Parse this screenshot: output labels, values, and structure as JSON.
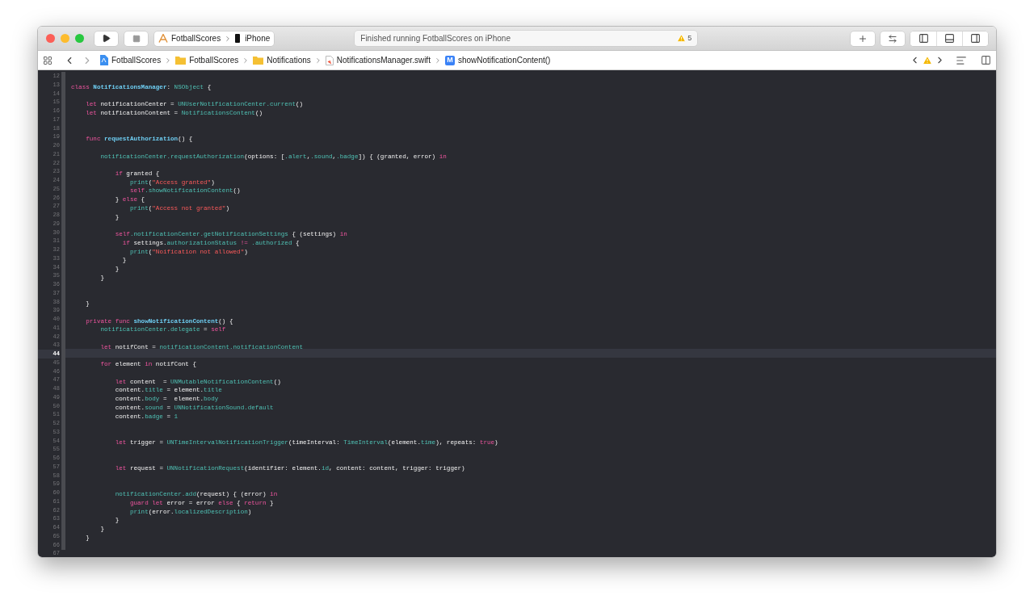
{
  "toolbar": {
    "scheme": {
      "project": "FotballScores",
      "device": "iPhone"
    },
    "activity": {
      "status": "Finished running FotballScores on iPhone",
      "warnings": "5"
    },
    "panels": [
      {
        "kind": "navigator",
        "selected": false
      },
      {
        "kind": "debug",
        "selected": false
      },
      {
        "kind": "inspector",
        "selected": false
      }
    ]
  },
  "jump_bar": {
    "crumbs": [
      {
        "kind": "project",
        "label": "FotballScores"
      },
      {
        "kind": "folder",
        "label": "FotballScores"
      },
      {
        "kind": "folder",
        "label": "Notifications"
      },
      {
        "kind": "file",
        "label": "NotificationsManager.swift"
      },
      {
        "kind": "method",
        "badge": "M",
        "label": "showNotificationContent()"
      }
    ]
  },
  "editor": {
    "lines": [
      {
        "number": "12",
        "current": false
      },
      {
        "number": "13",
        "current": false,
        "tokens": [
          {
            "kind": "keyword",
            "text": "class "
          },
          {
            "kind": "decl",
            "text": "NotificationsManager"
          },
          {
            "kind": "plain",
            "text": ": "
          },
          {
            "kind": "type",
            "text": "NSObject"
          },
          {
            "kind": "plain",
            "text": " {"
          }
        ]
      },
      {
        "number": "14",
        "current": false
      },
      {
        "number": "15",
        "current": false,
        "tokens": [
          {
            "kind": "keyword",
            "text": "    let "
          },
          {
            "kind": "plain",
            "text": "notificationCenter = "
          },
          {
            "kind": "type",
            "text": "UNUserNotificationCenter.current"
          },
          {
            "kind": "plain",
            "text": "()"
          }
        ]
      },
      {
        "number": "16",
        "current": false,
        "tokens": [
          {
            "kind": "keyword",
            "text": "    let "
          },
          {
            "kind": "plain",
            "text": "notificationContent = "
          },
          {
            "kind": "type",
            "text": "NotificationsContent"
          },
          {
            "kind": "plain",
            "text": "()"
          }
        ]
      },
      {
        "number": "17",
        "current": false
      },
      {
        "number": "18",
        "current": false
      },
      {
        "number": "19",
        "current": false,
        "tokens": [
          {
            "kind": "keyword",
            "text": "    func "
          },
          {
            "kind": "decl",
            "text": "requestAuthorization"
          },
          {
            "kind": "plain",
            "text": "() {"
          }
        ]
      },
      {
        "number": "20",
        "current": false
      },
      {
        "number": "21",
        "current": false,
        "tokens": [
          {
            "kind": "type",
            "text": "        notificationCenter.requestAuthorization"
          },
          {
            "kind": "plain",
            "text": "(options: ["
          },
          {
            "kind": "type",
            "text": ".alert"
          },
          {
            "kind": "plain",
            "text": ","
          },
          {
            "kind": "type",
            "text": ".sound"
          },
          {
            "kind": "plain",
            "text": ","
          },
          {
            "kind": "type",
            "text": ".badge"
          },
          {
            "kind": "plain",
            "text": "]) { (granted, error) "
          },
          {
            "kind": "keyword",
            "text": "in"
          }
        ]
      },
      {
        "number": "22",
        "current": false
      },
      {
        "number": "23",
        "current": false,
        "tokens": [
          {
            "kind": "keyword",
            "text": "            if "
          },
          {
            "kind": "plain",
            "text": "granted {"
          }
        ]
      },
      {
        "number": "24",
        "current": false,
        "tokens": [
          {
            "kind": "type",
            "text": "                print"
          },
          {
            "kind": "plain",
            "text": "("
          },
          {
            "kind": "string",
            "text": "\"Access granted\""
          },
          {
            "kind": "plain",
            "text": ")"
          }
        ]
      },
      {
        "number": "25",
        "current": false,
        "tokens": [
          {
            "kind": "keyword",
            "text": "                self"
          },
          {
            "kind": "type",
            "text": ".showNotificationContent"
          },
          {
            "kind": "plain",
            "text": "()"
          }
        ]
      },
      {
        "number": "26",
        "current": false,
        "tokens": [
          {
            "kind": "plain",
            "text": "            } "
          },
          {
            "kind": "keyword",
            "text": "else"
          },
          {
            "kind": "plain",
            "text": " {"
          }
        ]
      },
      {
        "number": "27",
        "current": false,
        "tokens": [
          {
            "kind": "type",
            "text": "                print"
          },
          {
            "kind": "plain",
            "text": "("
          },
          {
            "kind": "string",
            "text": "\"Access not granted\""
          },
          {
            "kind": "plain",
            "text": ")"
          }
        ]
      },
      {
        "number": "28",
        "current": false,
        "tokens": [
          {
            "kind": "plain",
            "text": "            }"
          }
        ]
      },
      {
        "number": "29",
        "current": false
      },
      {
        "number": "30",
        "current": false,
        "tokens": [
          {
            "kind": "keyword",
            "text": "            self"
          },
          {
            "kind": "type",
            "text": ".notificationCenter.getNotificationSettings"
          },
          {
            "kind": "plain",
            "text": " { (settings) "
          },
          {
            "kind": "keyword",
            "text": "in"
          }
        ]
      },
      {
        "number": "31",
        "current": false,
        "tokens": [
          {
            "kind": "keyword",
            "text": "              if "
          },
          {
            "kind": "plain",
            "text": "settings."
          },
          {
            "kind": "type",
            "text": "authorizationStatus"
          },
          {
            "kind": "keyword",
            "text": " != "
          },
          {
            "kind": "type",
            "text": ".authorized"
          },
          {
            "kind": "plain",
            "text": " {"
          }
        ]
      },
      {
        "number": "32",
        "current": false,
        "tokens": [
          {
            "kind": "type",
            "text": "                print"
          },
          {
            "kind": "plain",
            "text": "("
          },
          {
            "kind": "string",
            "text": "\"Noification not allowed\""
          },
          {
            "kind": "plain",
            "text": ")"
          }
        ]
      },
      {
        "number": "33",
        "current": false,
        "tokens": [
          {
            "kind": "plain",
            "text": "              }"
          }
        ]
      },
      {
        "number": "34",
        "current": false,
        "tokens": [
          {
            "kind": "plain",
            "text": "            }"
          }
        ]
      },
      {
        "number": "35",
        "current": false,
        "tokens": [
          {
            "kind": "plain",
            "text": "        }"
          }
        ]
      },
      {
        "number": "36",
        "current": false
      },
      {
        "number": "37",
        "current": false
      },
      {
        "number": "38",
        "current": false,
        "tokens": [
          {
            "kind": "plain",
            "text": "    }"
          }
        ]
      },
      {
        "number": "39",
        "current": false
      },
      {
        "number": "40",
        "current": false,
        "tokens": [
          {
            "kind": "keyword",
            "text": "    private func "
          },
          {
            "kind": "decl",
            "text": "showNotificationContent"
          },
          {
            "kind": "plain",
            "text": "() {"
          }
        ]
      },
      {
        "number": "41",
        "current": false,
        "tokens": [
          {
            "kind": "type",
            "text": "        notificationCenter.delegate"
          },
          {
            "kind": "plain",
            "text": " = "
          },
          {
            "kind": "keyword",
            "text": "self"
          }
        ]
      },
      {
        "number": "42",
        "current": false
      },
      {
        "number": "43",
        "current": false,
        "tokens": [
          {
            "kind": "keyword",
            "text": "        let "
          },
          {
            "kind": "plain",
            "text": "notifCont = "
          },
          {
            "kind": "type",
            "text": "notificationContent.notificationContent"
          }
        ]
      },
      {
        "number": "44",
        "current": true
      },
      {
        "number": "45",
        "current": false,
        "tokens": [
          {
            "kind": "keyword",
            "text": "        for "
          },
          {
            "kind": "plain",
            "text": "element "
          },
          {
            "kind": "keyword",
            "text": "in "
          },
          {
            "kind": "plain",
            "text": "notifCont {"
          }
        ]
      },
      {
        "number": "46",
        "current": false
      },
      {
        "number": "47",
        "current": false,
        "tokens": [
          {
            "kind": "keyword",
            "text": "            let "
          },
          {
            "kind": "plain",
            "text": "content  = "
          },
          {
            "kind": "type",
            "text": "UNMutableNotificationContent"
          },
          {
            "kind": "plain",
            "text": "()"
          }
        ]
      },
      {
        "number": "48",
        "current": false,
        "tokens": [
          {
            "kind": "plain",
            "text": "            content."
          },
          {
            "kind": "type",
            "text": "title"
          },
          {
            "kind": "plain",
            "text": " = element."
          },
          {
            "kind": "type",
            "text": "title"
          }
        ]
      },
      {
        "number": "49",
        "current": false,
        "tokens": [
          {
            "kind": "plain",
            "text": "            content."
          },
          {
            "kind": "type",
            "text": "body"
          },
          {
            "kind": "plain",
            "text": " =  element."
          },
          {
            "kind": "type",
            "text": "body"
          }
        ]
      },
      {
        "number": "50",
        "current": false,
        "tokens": [
          {
            "kind": "plain",
            "text": "            content."
          },
          {
            "kind": "type",
            "text": "sound"
          },
          {
            "kind": "plain",
            "text": " = "
          },
          {
            "kind": "type",
            "text": "UNNotificationSound.default"
          }
        ]
      },
      {
        "number": "51",
        "current": false,
        "tokens": [
          {
            "kind": "plain",
            "text": "            content."
          },
          {
            "kind": "type",
            "text": "badge"
          },
          {
            "kind": "plain",
            "text": " = "
          },
          {
            "kind": "type",
            "text": "1"
          }
        ]
      },
      {
        "number": "52",
        "current": false
      },
      {
        "number": "53",
        "current": false
      },
      {
        "number": "54",
        "current": false,
        "tokens": [
          {
            "kind": "keyword",
            "text": "            let "
          },
          {
            "kind": "plain",
            "text": "trigger = "
          },
          {
            "kind": "type",
            "text": "UNTimeIntervalNotificationTrigger"
          },
          {
            "kind": "plain",
            "text": "(timeInterval: "
          },
          {
            "kind": "type",
            "text": "TimeInterval"
          },
          {
            "kind": "plain",
            "text": "(element."
          },
          {
            "kind": "type",
            "text": "time"
          },
          {
            "kind": "plain",
            "text": "), repeats: "
          },
          {
            "kind": "keyword",
            "text": "true"
          },
          {
            "kind": "plain",
            "text": ")"
          }
        ]
      },
      {
        "number": "55",
        "current": false
      },
      {
        "number": "56",
        "current": false
      },
      {
        "number": "57",
        "current": false,
        "tokens": [
          {
            "kind": "keyword",
            "text": "            let "
          },
          {
            "kind": "plain",
            "text": "request = "
          },
          {
            "kind": "type",
            "text": "UNNotificationRequest"
          },
          {
            "kind": "plain",
            "text": "(identifier: element."
          },
          {
            "kind": "type",
            "text": "id"
          },
          {
            "kind": "plain",
            "text": ", content: content, trigger: trigger)"
          }
        ]
      },
      {
        "number": "58",
        "current": false
      },
      {
        "number": "59",
        "current": false
      },
      {
        "number": "60",
        "current": false,
        "tokens": [
          {
            "kind": "type",
            "text": "            notificationCenter.add"
          },
          {
            "kind": "plain",
            "text": "(request) { (error) "
          },
          {
            "kind": "keyword",
            "text": "in"
          }
        ]
      },
      {
        "number": "61",
        "current": false,
        "tokens": [
          {
            "kind": "keyword",
            "text": "                guard let "
          },
          {
            "kind": "plain",
            "text": "error = error "
          },
          {
            "kind": "keyword",
            "text": "else"
          },
          {
            "kind": "plain",
            "text": " { "
          },
          {
            "kind": "keyword",
            "text": "return"
          },
          {
            "kind": "plain",
            "text": " }"
          }
        ]
      },
      {
        "number": "62",
        "current": false,
        "tokens": [
          {
            "kind": "type",
            "text": "                print"
          },
          {
            "kind": "plain",
            "text": "(error."
          },
          {
            "kind": "type",
            "text": "localizedDescription"
          },
          {
            "kind": "plain",
            "text": ")"
          }
        ]
      },
      {
        "number": "63",
        "current": false,
        "tokens": [
          {
            "kind": "plain",
            "text": "            }"
          }
        ]
      },
      {
        "number": "64",
        "current": false,
        "tokens": [
          {
            "kind": "plain",
            "text": "        }"
          }
        ]
      },
      {
        "number": "65",
        "current": false,
        "tokens": [
          {
            "kind": "plain",
            "text": "    }"
          }
        ]
      },
      {
        "number": "66",
        "current": false
      },
      {
        "number": "67",
        "current": false
      }
    ]
  }
}
